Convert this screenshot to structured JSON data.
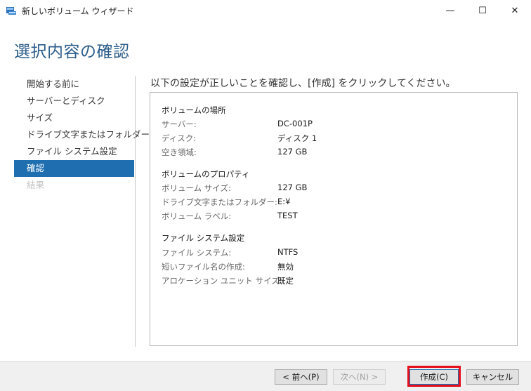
{
  "window": {
    "title": "新しいボリューム ウィザード",
    "app_icon": "volume-wizard-icon",
    "controls": {
      "minimize": "—",
      "maximize": "☐",
      "close": "✕"
    }
  },
  "page_title": "選択内容の確認",
  "nav": {
    "items": [
      {
        "label": "開始する前に",
        "state": "normal"
      },
      {
        "label": "サーバーとディスク",
        "state": "normal"
      },
      {
        "label": "サイズ",
        "state": "normal"
      },
      {
        "label": "ドライブ文字またはフォルダー",
        "state": "normal"
      },
      {
        "label": "ファイル システム設定",
        "state": "normal"
      },
      {
        "label": "確認",
        "state": "active"
      },
      {
        "label": "結果",
        "state": "disabled"
      }
    ]
  },
  "instruction": "以下の設定が正しいことを確認し、[作成] をクリックしてください。",
  "summary": {
    "sections": [
      {
        "title": "ボリュームの場所",
        "rows": [
          {
            "label": "サーバー:",
            "value": "DC-001P"
          },
          {
            "label": "ディスク:",
            "value": "ディスク 1"
          },
          {
            "label": "空き領域:",
            "value": "127 GB"
          }
        ]
      },
      {
        "title": "ボリュームのプロパティ",
        "rows": [
          {
            "label": "ボリューム サイズ:",
            "value": "127 GB"
          },
          {
            "label": "ドライブ文字またはフォルダー:",
            "value": "E:¥"
          },
          {
            "label": "ボリューム ラベル:",
            "value": "TEST"
          }
        ]
      },
      {
        "title": "ファイル システム設定",
        "rows": [
          {
            "label": "ファイル システム:",
            "value": "NTFS"
          },
          {
            "label": "短いファイル名の作成:",
            "value": "無効"
          },
          {
            "label": "アロケーション ユニット サイズ:",
            "value": "既定"
          }
        ]
      }
    ]
  },
  "buttons": {
    "prev": "< 前へ(P)",
    "next": "次へ(N) >",
    "create": "作成(C)",
    "cancel": "キャンセル"
  },
  "colors": {
    "accent": "#1e6eb0",
    "title": "#2c5d8a",
    "highlight": "#e5101d"
  }
}
